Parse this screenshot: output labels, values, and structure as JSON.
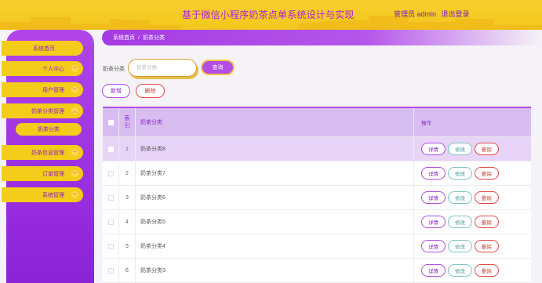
{
  "header": {
    "title": "基于微信小程序奶茶点单系统设计与实现",
    "user_label": "管理员 admin",
    "logout_label": "退出登录"
  },
  "sidebar": {
    "items": [
      {
        "label": "系统首页",
        "has_arrow": false
      },
      {
        "label": "个人中心",
        "has_arrow": true
      },
      {
        "label": "用户管理",
        "has_arrow": true
      },
      {
        "label": "奶茶分类管理",
        "has_arrow": true,
        "expanded": true
      },
      {
        "label": "奶茶信息管理",
        "has_arrow": true
      },
      {
        "label": "订单管理",
        "has_arrow": true
      },
      {
        "label": "系统管理",
        "has_arrow": true
      }
    ],
    "submenu": {
      "label": "奶茶分类"
    }
  },
  "breadcrumb": {
    "home": "系统首页",
    "separator": "/",
    "current": "奶茶分类"
  },
  "search": {
    "label": "奶茶分类",
    "placeholder": "奶茶分类",
    "button_label": "查询"
  },
  "toolbar": {
    "add_label": "新增",
    "delete_label": "删除"
  },
  "table": {
    "columns": {
      "no_line1": "索",
      "no_line2": "引",
      "name": "奶茶分类",
      "ops": "操作"
    },
    "rows": [
      {
        "no": "1",
        "name": "奶茶分类8",
        "selected": true
      },
      {
        "no": "2",
        "name": "奶茶分类7",
        "selected": false
      },
      {
        "no": "3",
        "name": "奶茶分类6",
        "selected": false
      },
      {
        "no": "4",
        "name": "奶茶分类5",
        "selected": false
      },
      {
        "no": "5",
        "name": "奶茶分类4",
        "selected": false
      },
      {
        "no": "6",
        "name": "奶茶分类3",
        "selected": false
      }
    ],
    "ops": {
      "detail": "详情",
      "edit": "修改",
      "delete": "删除"
    }
  },
  "colors": {
    "accent": "#b24ee6",
    "header_bg": "#f4cc1a",
    "danger": "#e04a4a"
  }
}
